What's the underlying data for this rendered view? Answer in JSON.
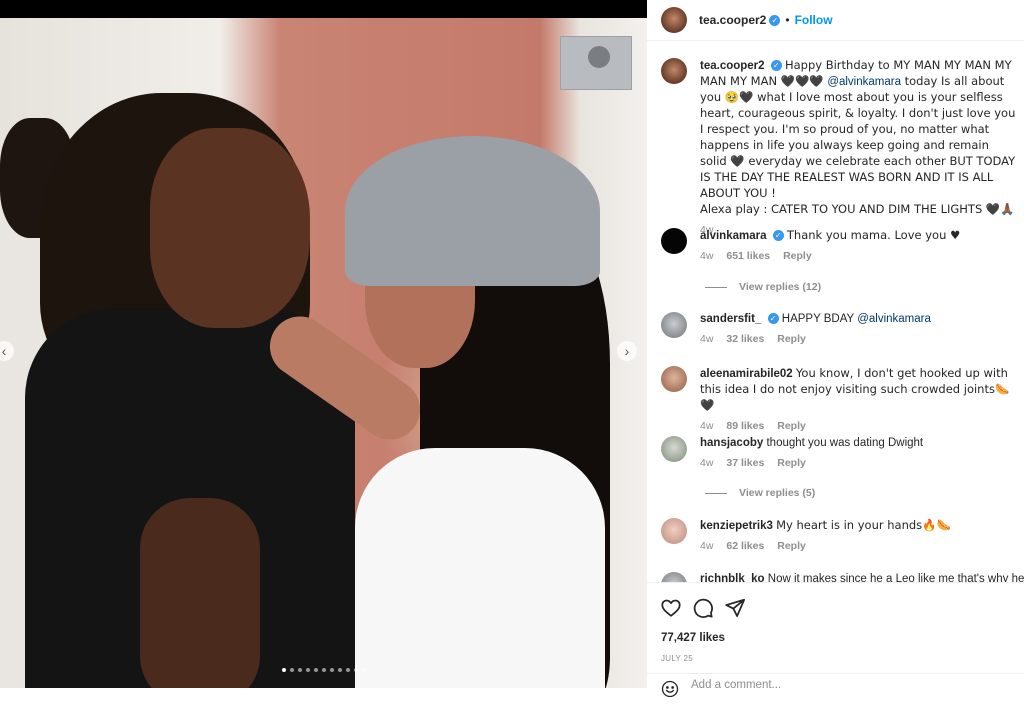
{
  "post": {
    "author": "tea.cooper2",
    "follow_label": "Follow",
    "header_separator": "•",
    "caption": {
      "username": "tea.cooper2",
      "text_1": "Happy Birthday to MY MAN MY MAN MY MAN MY MAN 🖤🖤🖤 ",
      "mention": "@alvinkamara",
      "text_2": " today Is all about you 🥹🖤 what I love most about you is your selfless heart, courageous spirit, & loyalty. I don't just love you I respect you. I'm so proud of you, no matter what happens in life you always keep going and remain solid 🖤 everyday we celebrate each other BUT TODAY IS THE DAY THE REALEST WAS BORN AND IT IS ALL ABOUT YOU !",
      "text_3": "Alexa play : CATER TO YOU AND DIM THE LIGHTS 🖤🙏🏾",
      "time": "4w"
    },
    "likes": "77,427 likes",
    "date": "JULY 25",
    "add_comment_placeholder": "Add a comment..."
  },
  "comments": [
    {
      "username": "alvinkamara",
      "verified": true,
      "text": "Thank you mama. Love you ♥",
      "time": "4w",
      "likes": "651 likes",
      "reply": "Reply",
      "view_replies": "View replies (12)"
    },
    {
      "username": "sandersfit_",
      "verified": true,
      "mention": "@alvinkamara",
      "text": "HAPPY BDAY ",
      "time": "4w",
      "likes": "32 likes",
      "reply": "Reply"
    },
    {
      "username": "aleenamirabile02",
      "text": "You know, I don't get hooked up with this idea I do not enjoy visiting such crowded joints🌭🖤",
      "time": "4w",
      "likes": "89 likes",
      "reply": "Reply"
    },
    {
      "username": "hansjacoby",
      "text": "thought you was dating Dwight",
      "time": "4w",
      "likes": "37 likes",
      "reply": "Reply",
      "view_replies": "View replies (5)"
    },
    {
      "username": "kenziepetrik3",
      "text": "My heart is in your hands🔥🌭",
      "time": "4w",
      "likes": "62 likes",
      "reply": "Reply"
    },
    {
      "username": "richnblk_ko",
      "text": "Now it makes since he a Leo like me that's why he"
    }
  ],
  "icons": {
    "verified": "verified-check-icon",
    "like": "heart-icon",
    "comment": "speech-bubble-icon",
    "share": "paper-plane-icon",
    "emoji": "smiley-icon",
    "prev": "chevron-left-icon",
    "next": "chevron-right-icon"
  },
  "colors": {
    "accent": "#0095f6",
    "verified": "#3897f0",
    "secondary_text": "#8e8e8e",
    "mention": "#00376b"
  },
  "carousel": {
    "count": 11,
    "active_index": 0
  }
}
